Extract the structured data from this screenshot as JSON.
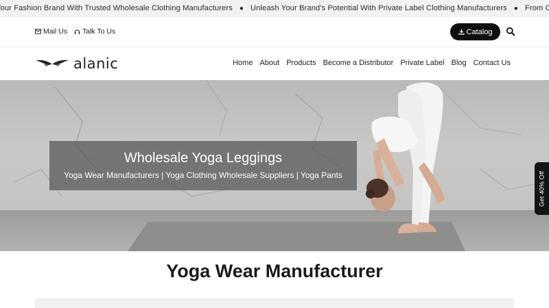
{
  "ticker": {
    "items": [
      "Your Fashion Brand With Trusted Wholesale Clothing Manufacturers",
      "Unleash Your Brand's Potential With Private Label Clothing Manufacturers",
      "From Concept To Creatio"
    ],
    "separator": "●"
  },
  "utility": {
    "mail_label": "Mail Us",
    "talk_label": "Talk To Us",
    "catalog_label": "Catalog"
  },
  "logo": {
    "text": "alanic"
  },
  "nav": {
    "items": [
      "Home",
      "About",
      "Products",
      "Become a Distributor",
      "Private Label",
      "Blog",
      "Contact Us"
    ]
  },
  "hero": {
    "title": "Wholesale Yoga Leggings",
    "subtitle": "Yoga Wear Manufacturers | Yoga Clothing Wholesale Suppliers | Yoga Pants"
  },
  "promo": {
    "label": "Get 40% Off"
  },
  "section": {
    "title": "Yoga Wear Manufacturer"
  },
  "colors": {
    "accent": "#0e0e0e",
    "ticker_bg": "#f2f2f2",
    "overlay": "#555555"
  },
  "icons": {
    "mail": "envelope-icon",
    "talk": "headset-icon",
    "catalog": "download-icon",
    "search": "search-icon",
    "logo": "wings-icon"
  }
}
